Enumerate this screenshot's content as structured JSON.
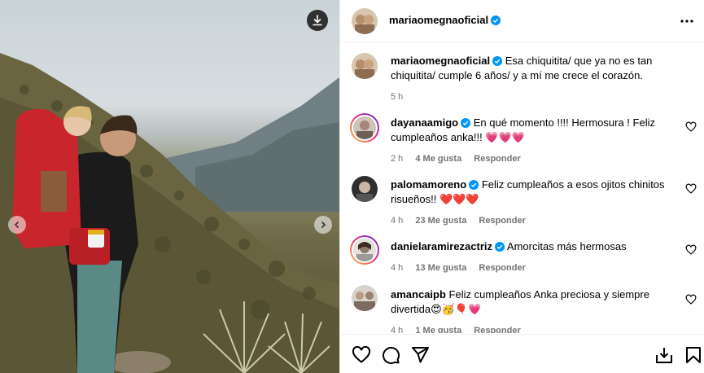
{
  "post": {
    "username": "mariaomegnaoficial",
    "caption_text": "Esa chiquitita/ que ya no es tan chiquitita/ cumple 6 años/ y a mí me crece el corazón.",
    "caption_time": "5 h"
  },
  "comments": [
    {
      "username": "dayanaamigo",
      "text": "En qué momento !!!! Hermosura ! Feliz cumpleaños anka!!! 💗💗💗",
      "time": "2 h",
      "likes": "4 Me gusta",
      "reply": "Responder"
    },
    {
      "username": "palomamoreno",
      "text": "Feliz cumpleaños a esos ojitos chinitos risueños!! ❤️❤️❤️",
      "time": "4 h",
      "likes": "23 Me gusta",
      "reply": "Responder"
    },
    {
      "username": "danielaramirezactriz",
      "text": "Amorcitas más hermosas",
      "time": "4 h",
      "likes": "13 Me gusta",
      "reply": "Responder"
    },
    {
      "username": "amancaipb",
      "text": "Feliz cumpleaños Anka preciosa y siempre divertida😍🥳🎈💗",
      "time": "4 h",
      "likes": "1 Me gusta",
      "reply": "Responder"
    }
  ],
  "icons": {
    "download": "download-icon",
    "more": "more-options-icon",
    "like": "heart-icon",
    "comment": "comment-icon",
    "share": "share-icon",
    "save": "bookmark-icon"
  },
  "colors": {
    "verified": "#0095f6",
    "meta_text": "#737373",
    "border": "#efefef"
  }
}
